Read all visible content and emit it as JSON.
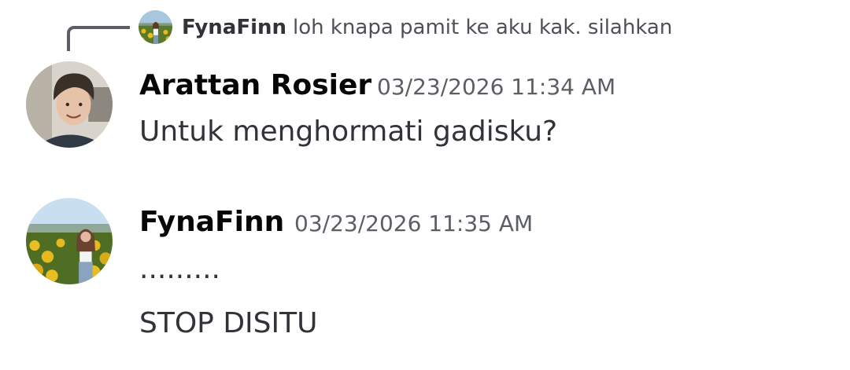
{
  "reply": {
    "author": "FynaFinn",
    "text": "loh knapa pamit ke aku kak. silahkan",
    "avatar_icon": "sunflower-field-avatar"
  },
  "messages": [
    {
      "author": "Arattan Rosier",
      "timestamp": "03/23/2026 11:34 AM",
      "avatar_icon": "curly-hair-man-avatar",
      "lines": [
        "Untuk menghormati gadisku?"
      ]
    },
    {
      "author": "FynaFinn",
      "timestamp": "03/23/2026 11:35 AM",
      "avatar_icon": "sunflower-field-avatar",
      "lines": [
        ".........",
        "STOP DISITU"
      ]
    }
  ],
  "colors": {
    "background": "#ffffff",
    "reply_line": "#5c5e66",
    "author": "#060607",
    "text": "#313338",
    "timestamp": "#5c5e66"
  }
}
